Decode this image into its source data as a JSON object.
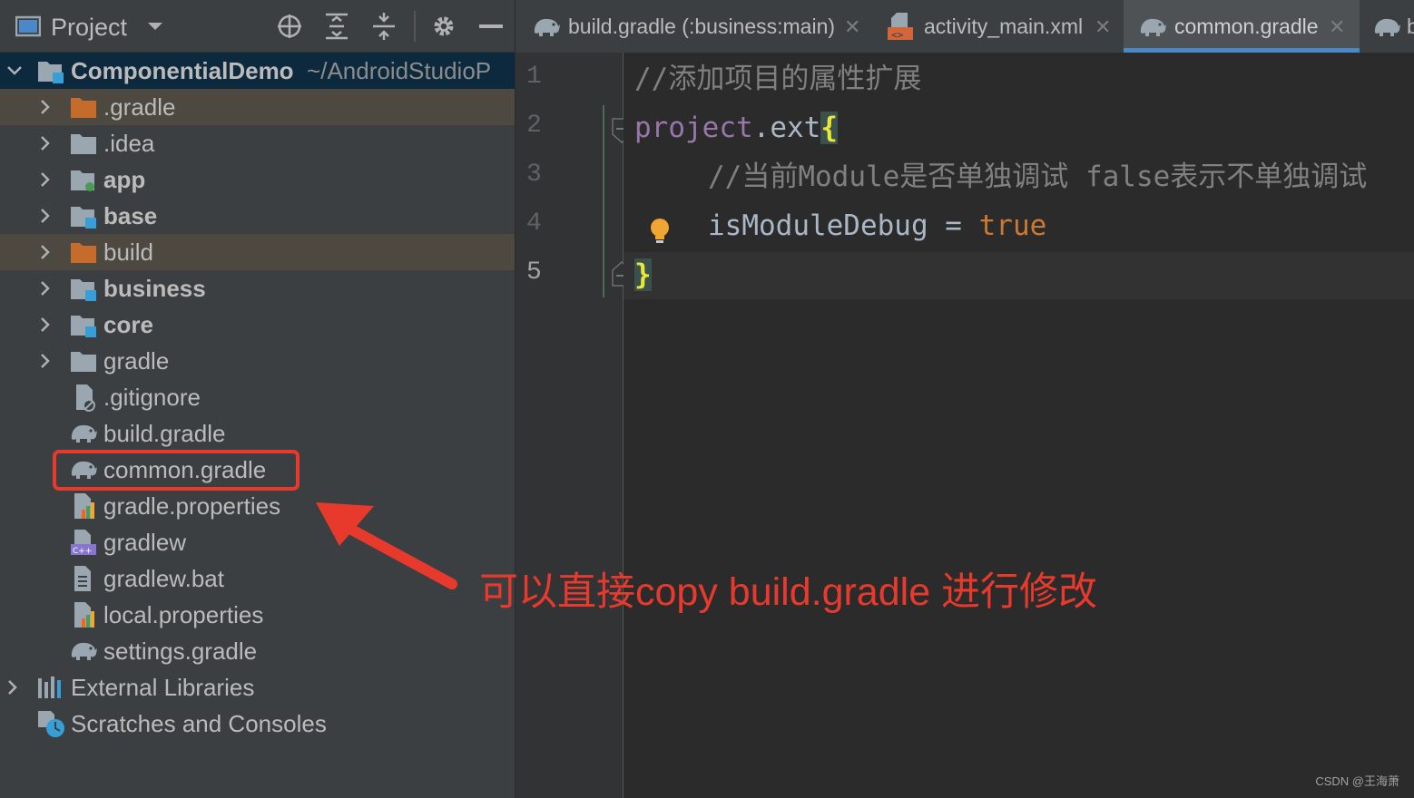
{
  "project_window": {
    "title": "Project",
    "icons": [
      "project-view-icon",
      "dropdown-arrow-icon",
      "locate-target-icon",
      "expand-all-icon",
      "collapse-all-icon",
      "gear-icon",
      "hide-icon"
    ]
  },
  "tree": {
    "root": {
      "name": "ComponentialDemo",
      "path": "~/AndroidStudioP"
    },
    "items": [
      {
        "label": ".gradle",
        "icon": "folder-excluded-icon"
      },
      {
        "label": ".idea",
        "icon": "folder-icon"
      },
      {
        "label": "app",
        "icon": "module-app-icon"
      },
      {
        "label": "base",
        "icon": "module-icon"
      },
      {
        "label": "build",
        "icon": "folder-excluded-icon"
      },
      {
        "label": "business",
        "icon": "module-icon"
      },
      {
        "label": "core",
        "icon": "module-icon"
      },
      {
        "label": "gradle",
        "icon": "folder-icon"
      },
      {
        "label": ".gitignore",
        "icon": "gitignore-file-icon"
      },
      {
        "label": "build.gradle",
        "icon": "gradle-elephant-icon"
      },
      {
        "label": "common.gradle",
        "icon": "gradle-elephant-icon"
      },
      {
        "label": "gradle.properties",
        "icon": "properties-file-icon"
      },
      {
        "label": "gradlew",
        "icon": "script-file-icon"
      },
      {
        "label": "gradlew.bat",
        "icon": "text-file-icon"
      },
      {
        "label": "local.properties",
        "icon": "properties-file-icon"
      },
      {
        "label": "settings.gradle",
        "icon": "gradle-elephant-icon"
      }
    ],
    "external_libraries": "External Libraries",
    "scratches": "Scratches and Consoles"
  },
  "tabs": [
    {
      "label": "build.gradle (:business:main)",
      "icon": "gradle-elephant-icon",
      "active": false
    },
    {
      "label": "activity_main.xml",
      "icon": "xml-layout-icon",
      "active": false
    },
    {
      "label": "common.gradle",
      "icon": "gradle-elephant-icon",
      "active": true
    },
    {
      "label": "b",
      "icon": "gradle-elephant-icon",
      "active": false
    }
  ],
  "editor": {
    "line_numbers": [
      "1",
      "2",
      "3",
      "4",
      "5"
    ],
    "lines": {
      "l1_comment": "//添加项目的属性扩展",
      "l2_ident": "project",
      "l2_dot": ".",
      "l2_ext": "ext",
      "l2_brace": "{",
      "l3_comment": "//当前Module是否单独调试 false表示不单独调试",
      "l4_name": "isModuleDebug",
      "l4_eq": " = ",
      "l4_value": "true",
      "l5_brace": "}"
    }
  },
  "annotation": {
    "text": "可以直接copy build.gradle 进行修改",
    "color": "#e8392d"
  },
  "watermark": "CSDN @王海萧",
  "colors": {
    "tool_window_bg": "#3c3f41",
    "editor_bg": "#2b2b2b",
    "selection_bg": "#0d293e",
    "excluded_bg": "#4d4941",
    "active_tab_underline": "#4a88c7",
    "keyword": "#cc7832",
    "comment": "#808080",
    "brace": "#e8e838"
  }
}
